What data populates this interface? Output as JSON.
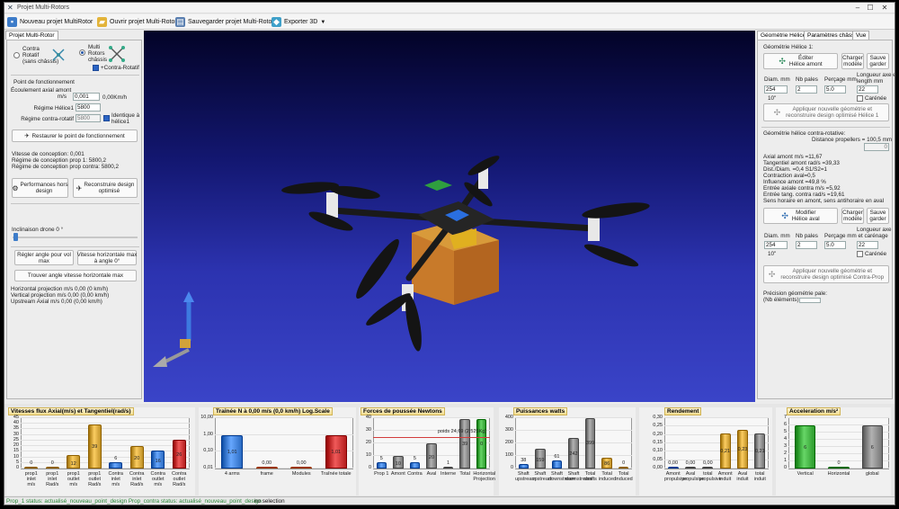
{
  "window": {
    "title": "Projet Multi-Rotors"
  },
  "toolbar": {
    "new_label": "Nouveau projet MultiRotor",
    "open_label": "Ouvrir projet Multi-Rotors",
    "save_label": "Sauvegarder projet Multi-Rotors",
    "export_label": "Exporter 3D"
  },
  "left": {
    "tab": "Projet Multi-Rotor",
    "radio_contra": "Contra\nRotatif\n(sans châssis)",
    "radio_multi": "Multi\nRotors\nchâssis",
    "contra_check_label": "+Contra-Rotatif",
    "fonct_title": "Point de fonctionnement",
    "ecoulement_label": "Écoulement axial amont\nm/s",
    "ecoulement_value": "0,001",
    "ecoulement_kmh": "0,00Km/h",
    "regime_label": "Régime Hélice1",
    "regime_value": "5800",
    "regime_contra_label": "Régime contra-rotatif",
    "regime_contra_value": "5800",
    "identique_label": "Identique à\nhélice1",
    "restore_btn": "Restaurer le point de fonctionnement",
    "vitesse_conception": "Vitesse de conception: 0,001",
    "regime_prop1": "Régime de conception prop 1: 5800,2",
    "regime_contra": "Régime de conception prop contra: 5800,2",
    "perf_btn": "Performances hors\ndesign",
    "reconstruire_btn": "Reconstruire design\noptimisé",
    "inclinaison_label": "Inclinaison drone 0 °",
    "regler_btn": "Régler angle pour vol\nmax",
    "vitesse_btn": "Vitesse horizontale max\nà angle 0°",
    "trouver_btn": "Trouver angle vitesse horizontale max",
    "horiz_proj": "Horizontal projection m/s 0,00 (0 km/h)",
    "vert_proj": "Vertical projection m/s 0,00 (0,00 km/h)",
    "upstream": "Upstream Axial m/s 0,00 (0,00 km/h)"
  },
  "right": {
    "tabs": [
      "Géométrie Hélices",
      "Paramètres châssis",
      "Vue"
    ],
    "geom1_title": "Géométrie Hélice 1:",
    "edit_btn": "Éditer\nHélice amont",
    "load_btn": "Charger\nmodèle",
    "save_btn": "Sauve\ngarder",
    "diam_label": "Diam. mm",
    "nb_pales_label": "Nb pales",
    "percage_label": "Perçage mm",
    "longueur_label": "Longueur axe et\nlength mm",
    "diam_value": "254",
    "nb_pales_value": "2",
    "percage_value": "5.0",
    "longueur_value": "22",
    "diam_inch": "10\"",
    "carenee_label": "Carénée",
    "apply1": "Appliquer nouvelle géométrie et\nreconstruire design optimisé Hélice 1",
    "geom_contra_title": "Géométrie hélice contra-rotative:",
    "distance_label": "Distance propellers = 100,5 mm",
    "distance_value": "0",
    "info_lines": [
      "Axial amont m/s =11,67",
      "Tangentiel amont rad/s =39,33",
      "Dist./Diam. =0,4 S1/S2=1",
      "Contraction aval=0,5",
      "Influence amont =49,8 %",
      "Entrée axiale contra m/s =5,92",
      "Entrée tang. contra rad/s =19,61",
      "Sens horaire en amont, sens antihoraire en aval"
    ],
    "modifier_btn": "Modifier\nHélice aval",
    "load_btn2": "Charger\nmodèle",
    "save_btn2": "Sauve\ngarder",
    "longueur2_label": "Longueur axe",
    "percage2_label": "Perçage mm et carénage",
    "diam2_value": "254",
    "nb2_value": "2",
    "percage2_value": "5.0",
    "longueur2_value": "22",
    "diam2_inch": "10\"",
    "apply2": "Appliquer nouvelle géométrie et\nreconstruire design optimisé Contra-Prop",
    "precision_label": "Précision géométrie pale:\n(Nb éléments)"
  },
  "colors": {
    "gold": "#d4a53a",
    "blue": "#3f7fd6",
    "gray": "#8a8a8a",
    "red": "#c83232",
    "orange": "#e07a3a",
    "green": "#3fae3f"
  },
  "chart_data": [
    {
      "type": "bar",
      "title": "Vitesses flux Axial(m/s) et Tangentiel(rad/s)",
      "ylim": [
        0,
        45
      ],
      "yticks": [
        "45",
        "40",
        "35",
        "30",
        "25",
        "20",
        "15",
        "10",
        "5",
        "0"
      ],
      "categories": [
        "prop1\ninlet\nm/s",
        "prop1\ninlet\nRad/s",
        "prop1\noutlet\nm/s",
        "prop1\noutlet\nRad/s",
        "Contra\ninlet\nm/s",
        "Contra\ninlet\nRad/s",
        "Contra\noutlet\nm/s",
        "Contra\noutlet\nRad/s"
      ],
      "values": [
        0,
        0,
        12,
        39,
        6,
        20,
        16,
        26
      ],
      "value_labels": [
        "0",
        "0",
        "12",
        "39",
        "6",
        "20",
        "16",
        "26"
      ],
      "colors": [
        "#d4a53a",
        "#d4a53a",
        "#d4a53a",
        "#d4a53a",
        "#3f7fd6",
        "#d4a53a",
        "#3f7fd6",
        "#c83232"
      ]
    },
    {
      "type": "bar",
      "title": "Traînée N à 0,00 m/s (0,0 km/h) Log.Scale",
      "ylim": [
        0,
        10
      ],
      "yticks": [
        "10,00",
        "1,00",
        "0,10",
        "0,01"
      ],
      "categories": [
        "4 arms",
        "frame",
        "Modules",
        "Traînée totale"
      ],
      "values": [
        1.01,
        0.0,
        0.0,
        1.01
      ],
      "value_labels": [
        "1,01",
        "0,00",
        "0,00",
        "1,01"
      ],
      "colors": [
        "#3f7fd6",
        "#e07a3a",
        "#e07a3a",
        "#c83232"
      ]
    },
    {
      "type": "bar",
      "title": "Forces de poussée Newtons",
      "ylim": [
        0,
        40
      ],
      "yticks": [
        "40",
        "30",
        "20",
        "10",
        "0"
      ],
      "annotation": "poids 24,69 (2,525Kg)",
      "categories": [
        "Prop 1",
        "Amont",
        "Contra",
        "Aval",
        "Interne",
        "Total",
        "Horizontal\nProjection"
      ],
      "values": [
        5,
        10,
        5,
        20,
        1,
        39,
        39
      ],
      "value_labels": [
        "5",
        "10",
        "5",
        "20",
        "1",
        "39",
        "0"
      ],
      "colors": [
        "#3f7fd6",
        "#8a8a8a",
        "#3f7fd6",
        "#8a8a8a",
        "#8a8a8a",
        "#8a8a8a",
        "#3fae3f"
      ]
    },
    {
      "type": "bar",
      "title": "Puissances watts",
      "ylim": [
        0,
        400
      ],
      "yticks": [
        "400",
        "300",
        "200",
        "100",
        "0"
      ],
      "categories": [
        "Shaft\nupstream",
        "Shaft\nupstream",
        "Shaft\ndownstream",
        "Shaft\ndownstream",
        "Total\nshafts",
        "Total\ninduced",
        "Total\ninduced"
      ],
      "values": [
        38,
        159,
        61,
        242,
        399,
        86,
        0
      ],
      "value_labels": [
        "38",
        "159",
        "61",
        "242",
        "399",
        "86",
        "0"
      ],
      "colors": [
        "#3f7fd6",
        "#8a8a8a",
        "#3f7fd6",
        "#8a8a8a",
        "#8a8a8a",
        "#d4a53a",
        "#d4a53a"
      ]
    },
    {
      "type": "bar",
      "title": "Rendement",
      "ylim": [
        0,
        0.3
      ],
      "yticks": [
        "0,30",
        "0,25",
        "0,20",
        "0,15",
        "0,10",
        "0,05",
        "0,00"
      ],
      "categories": [
        "Amont\npropulsive",
        "Aval\npropulsive",
        "total\npropulsive",
        "Amont\ninduit",
        "Aval\ninduit",
        "total\ninduit"
      ],
      "values": [
        0,
        0,
        0,
        0.21,
        0.23,
        0.21
      ],
      "value_labels": [
        "0,00",
        "0,00",
        "0,00",
        "0,21",
        "0,23",
        "0,21"
      ],
      "colors": [
        "#3f7fd6",
        "#8a8a8a",
        "#8a8a8a",
        "#d4a53a",
        "#d4a53a",
        "#8a8a8a"
      ]
    },
    {
      "type": "bar",
      "title": "Acceleration m/s²",
      "ylim": [
        0,
        7
      ],
      "yticks": [
        "7",
        "6",
        "5",
        "4",
        "3",
        "2",
        "1",
        "0"
      ],
      "categories": [
        "Vertical",
        "Horizontal",
        "global"
      ],
      "values": [
        6,
        0,
        6
      ],
      "value_labels": [
        "6",
        "0",
        "6"
      ],
      "colors": [
        "#3fae3f",
        "#3fae3f",
        "#8a8a8a"
      ]
    }
  ],
  "status": {
    "left": "Prop_1 status: actualisé_nouveau_point_design Prop_contra status: actualisé_nouveau_point_design",
    "right": "no selection"
  }
}
